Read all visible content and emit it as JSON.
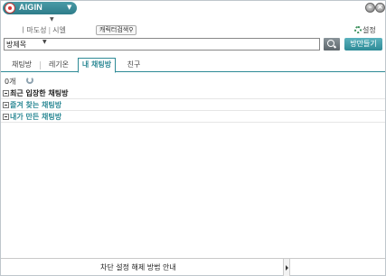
{
  "app": {
    "logo_text": "AIGIN"
  },
  "profile": {
    "status": "ㅣ마도성",
    "server": "시엘",
    "search_character_button": "캐릭터검색"
  },
  "settings_label": "설정",
  "search": {
    "type_selected": "방제목",
    "value": ""
  },
  "make_room_label": "방만들기",
  "tabs": [
    {
      "label": "채팅방"
    },
    {
      "label": "레기온"
    },
    {
      "label": "내 채팅방"
    },
    {
      "label": "친구"
    }
  ],
  "count_label": "0개",
  "groups": [
    {
      "label": "최근 입장한 채팅방"
    },
    {
      "label": "즐겨 찾는 채팅방"
    },
    {
      "label": "내가 만든 채팅방"
    }
  ],
  "bottom_notice": "차단 설정 해제 방법 안내",
  "colors": {
    "accent": "#2e8a96",
    "title_pill": "#3a8c98"
  }
}
